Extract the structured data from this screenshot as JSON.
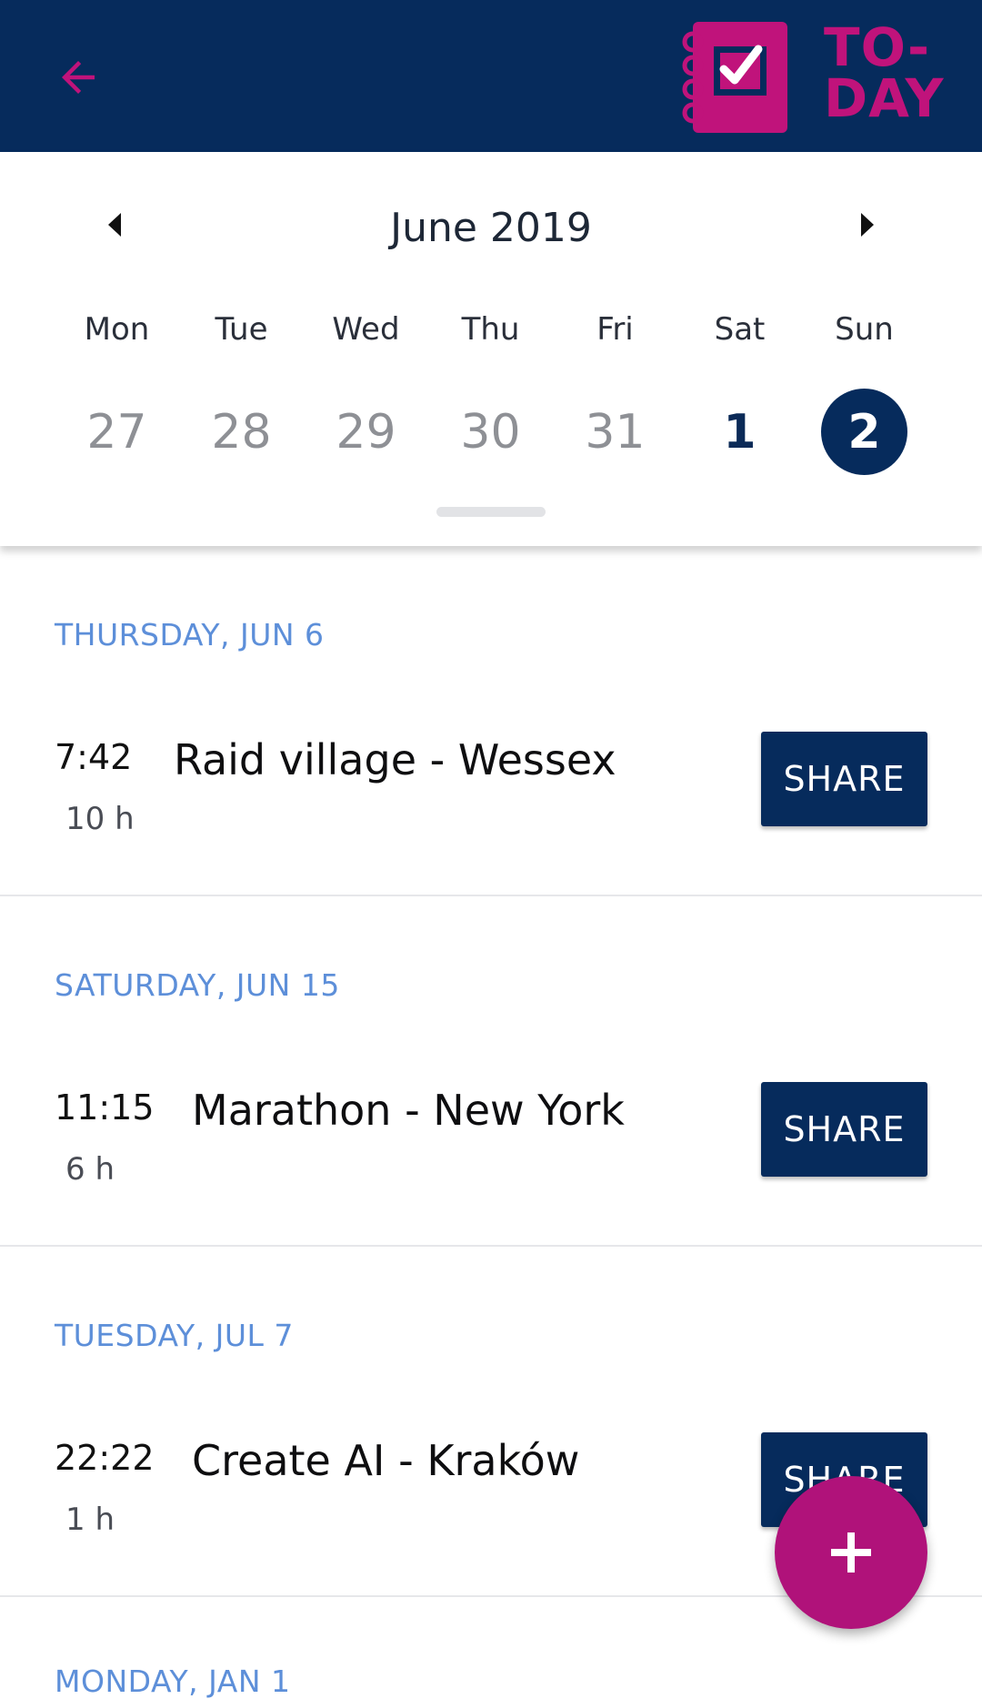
{
  "colors": {
    "navy": "#062b5c",
    "magenta": "#c0137b",
    "fab": "#b0127a",
    "day_header": "#5d8fd9"
  },
  "appbar": {
    "back_icon": "arrow-left-icon",
    "logo_icon": "checked-notebook-icon",
    "logo_line1": "TO-",
    "logo_line2": "DAY"
  },
  "calendar": {
    "month_label": "June 2019",
    "prev_icon": "caret-left-icon",
    "next_icon": "caret-right-icon",
    "weekdays": [
      "Mon",
      "Tue",
      "Wed",
      "Thu",
      "Fri",
      "Sat",
      "Sun"
    ],
    "dates": [
      {
        "label": "27",
        "state": "muted"
      },
      {
        "label": "28",
        "state": "muted"
      },
      {
        "label": "29",
        "state": "muted"
      },
      {
        "label": "30",
        "state": "muted"
      },
      {
        "label": "31",
        "state": "muted"
      },
      {
        "label": "1",
        "state": "current"
      },
      {
        "label": "2",
        "state": "selected"
      }
    ]
  },
  "events": [
    {
      "day": "THURSDAY, JUN 6",
      "time": "7:42",
      "duration": "10 h",
      "title": "Raid village - Wessex",
      "share_label": "SHARE"
    },
    {
      "day": "SATURDAY, JUN 15",
      "time": "11:15",
      "duration": "6 h",
      "title": "Marathon - New York",
      "share_label": "SHARE"
    },
    {
      "day": "TUESDAY, JUL 7",
      "time": "22:22",
      "duration": "1 h",
      "title": "Create AI - Kraków",
      "share_label": "SHARE"
    }
  ],
  "next_day_header": "MONDAY, JAN 1",
  "fab": {
    "icon": "plus-icon"
  }
}
